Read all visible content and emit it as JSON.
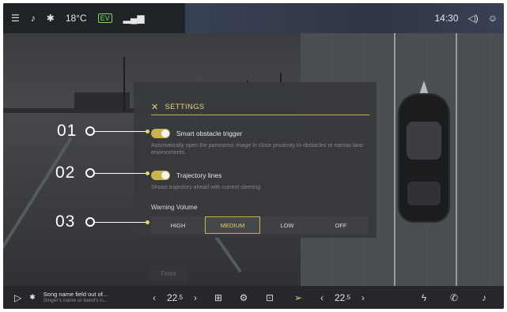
{
  "status_bar": {
    "temperature": "18°C",
    "ev_badge": "EV",
    "time": "14:30",
    "icons": [
      "settings-sliders-icon",
      "bell-icon",
      "bluetooth-icon",
      "ev-battery-icon",
      "signal-icon",
      "volume-icon",
      "user-icon"
    ]
  },
  "settings": {
    "title": "SETTINGS",
    "smart_obstacle": {
      "label": "Smart obstacle trigger",
      "description": "Automatically open the panoramic image in close proximity to obstacles or narrow lane environments.",
      "enabled": true
    },
    "trajectory": {
      "label": "Trajectory lines",
      "description": "Shows trajectory ahead with current steering",
      "enabled": true
    },
    "warning_volume": {
      "label": "Warning Volume",
      "options": [
        "HIGH",
        "MEDIUM",
        "LOW",
        "OFF"
      ],
      "selected": "MEDIUM"
    }
  },
  "callouts": [
    "01",
    "02",
    "03"
  ],
  "front_button": "Front",
  "bottom_bar": {
    "song": "Song name field out of...",
    "artist": "Singer's name or band's n...",
    "left_temp": "22",
    "left_temp_decimal": ".5",
    "right_temp": "22",
    "right_temp_decimal": ".5",
    "chevron_left": "‹",
    "chevron_right": "›"
  },
  "colors": {
    "accent": "#e8d36a",
    "panel_bg": "#37393d",
    "bar_bg": "#25272b"
  }
}
